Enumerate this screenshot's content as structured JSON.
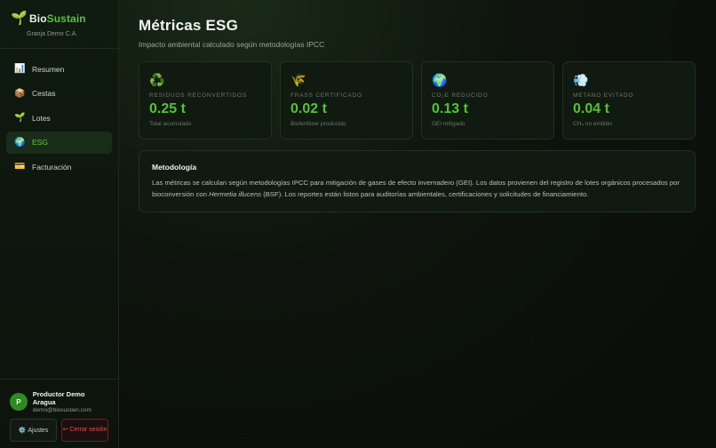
{
  "brand": {
    "logo_icon": "seedling-icon",
    "name_part1": "Bio",
    "name_part2": "Sustain",
    "org": "Granja Demo C.A.",
    "accent_color": "#58c23a"
  },
  "sidebar": {
    "items": [
      {
        "icon": "📊",
        "icon_name": "bar-chart-icon",
        "label": "Resumen",
        "active": false
      },
      {
        "icon": "📦",
        "icon_name": "package-icon",
        "label": "Cestas",
        "active": false
      },
      {
        "icon": "🌱",
        "icon_name": "seedling-icon",
        "label": "Lotes",
        "active": false
      },
      {
        "icon": "🌍",
        "icon_name": "globe-icon",
        "label": "ESG",
        "active": true
      },
      {
        "icon": "💳",
        "icon_name": "credit-card-icon",
        "label": "Facturación",
        "active": false
      }
    ]
  },
  "user": {
    "initial": "P",
    "name": "Productor Demo Aragua",
    "email": "demo@biosustain.com",
    "settings_icon": "⚙️",
    "settings_label": "Ajustes",
    "logout_icon": "↩",
    "logout_label": "Cerrar sesión"
  },
  "header": {
    "title": "Métricas ESG",
    "subtitle": "Impacto ambiental calculado según metodologías IPCC"
  },
  "cards": [
    {
      "icon": "♻️",
      "icon_name": "recycle-icon",
      "label": "Residuos reconvertidos",
      "value": "0.25 t",
      "note": "Total acumulado"
    },
    {
      "icon": "🌾",
      "icon_name": "wheat-icon",
      "label": "Frass certificado",
      "value": "0.02 t",
      "note": "Biofertilizer producido"
    },
    {
      "icon": "🌍",
      "icon_name": "globe-icon",
      "label": "CO₂e reducido",
      "value": "0.13 t",
      "note": "GEI mitigado"
    },
    {
      "icon": "💨",
      "icon_name": "wind-icon",
      "label": "Metano evitado",
      "value": "0.04 t",
      "note": "CH₄ no emitido"
    }
  ],
  "methodology": {
    "title": "Metodología",
    "text_part1": "Las métricas se calculan según metodologías IPCC para mitigación de gases de efecto invernadero (GEI). Los datos provienen del registro de lotes orgánicos procesados por bioconversión con ",
    "text_species": "Hermetia illucens",
    "text_part2": " (BSF). Los reportes están listos para auditorías ambientales, certificaciones y solicitudes de financiamiento."
  }
}
